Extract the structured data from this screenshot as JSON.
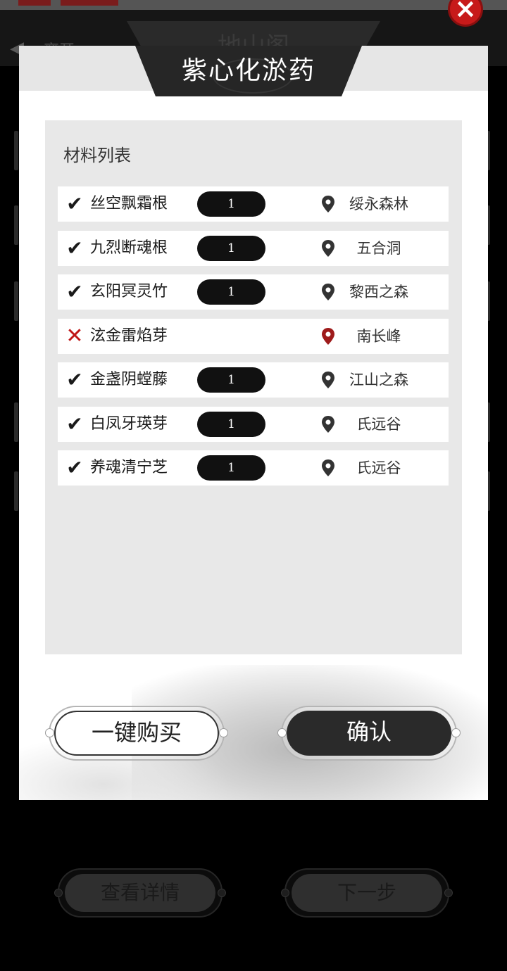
{
  "background": {
    "back_icon": "chevron-left-icon",
    "back_label": "离开",
    "page_title": "地山阁",
    "buttons": {
      "details_label": "查看详情",
      "next_label": "下一步"
    }
  },
  "close_icon": "close-icon",
  "modal": {
    "title": "紫心化淤药",
    "panel_label": "材料列表",
    "materials": [
      {
        "status": "✔",
        "status_icon": "checkmark-icon",
        "name": "丝空飘霜根",
        "qty": "1",
        "location": "绥永森林",
        "pin_color": "#333333"
      },
      {
        "status": "✔",
        "status_icon": "checkmark-icon",
        "name": "九烈断魂根",
        "qty": "1",
        "location": "五合洞",
        "pin_color": "#333333"
      },
      {
        "status": "✔",
        "status_icon": "checkmark-icon",
        "name": "玄阳冥灵竹",
        "qty": "1",
        "location": "黎西之森",
        "pin_color": "#333333"
      },
      {
        "status": "✕",
        "status_icon": "cross-icon",
        "name": "泫金雷焰芽",
        "qty": null,
        "location": "南长峰",
        "pin_color": "#9e1b1b"
      },
      {
        "status": "✔",
        "status_icon": "checkmark-icon",
        "name": "金盏阴螳藤",
        "qty": "1",
        "location": "江山之森",
        "pin_color": "#333333"
      },
      {
        "status": "✔",
        "status_icon": "checkmark-icon",
        "name": "白凤牙瑛芽",
        "qty": "1",
        "location": "氏远谷",
        "pin_color": "#333333"
      },
      {
        "status": "✔",
        "status_icon": "checkmark-icon",
        "name": "养魂清宁芝",
        "qty": "1",
        "location": "氏远谷",
        "pin_color": "#333333"
      }
    ],
    "buttons": {
      "buy_all_label": "一键购买",
      "confirm_label": "确认"
    }
  }
}
